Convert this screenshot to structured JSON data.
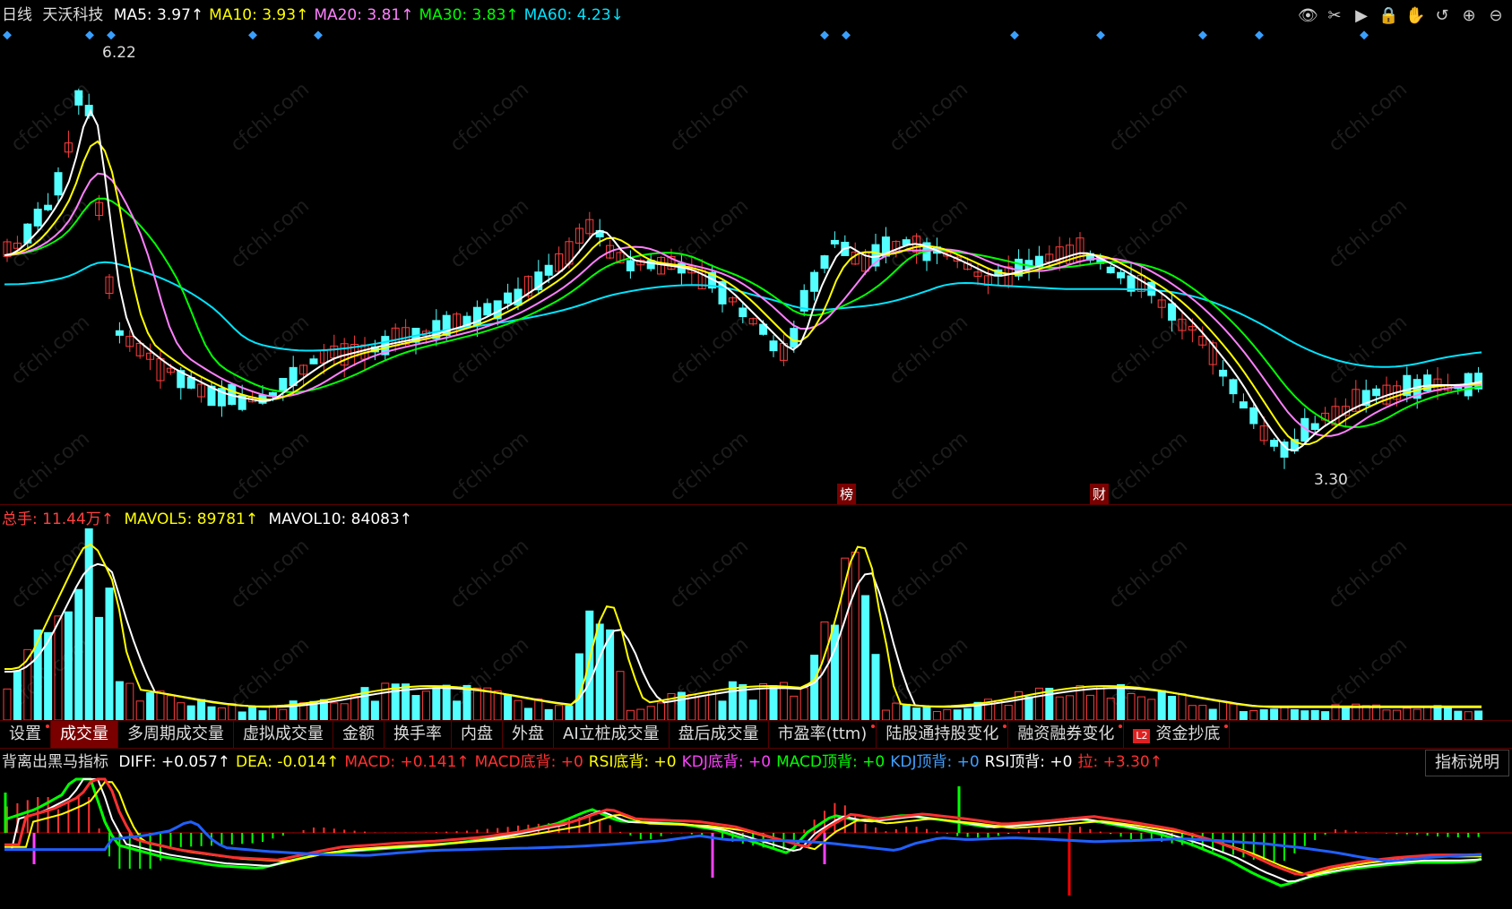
{
  "main": {
    "period": "日线",
    "stock_name": "天沃科技",
    "ma": [
      {
        "label": "MA5: 3.97↑",
        "color": "#ffffff"
      },
      {
        "label": "MA10: 3.93↑",
        "color": "#ffff00"
      },
      {
        "label": "MA20: 3.81↑",
        "color": "#ff80ff"
      },
      {
        "label": "MA30: 3.83↑",
        "color": "#00ff00"
      },
      {
        "label": "MA60: 4.23↓",
        "color": "#00e5ff"
      }
    ],
    "high_label": "6.22",
    "low_label": "3.30",
    "badge_bang": "榜",
    "badge_cai": "财"
  },
  "volume": {
    "total": "总手: 11.44万↑",
    "mavol5": "MAVOL5: 89781↑",
    "mavol10": "MAVOL10: 84083↑"
  },
  "tabs": [
    {
      "label": "设置",
      "dot": true
    },
    {
      "label": "成交量",
      "active": true
    },
    {
      "label": "多周期成交量"
    },
    {
      "label": "虚拟成交量"
    },
    {
      "label": "金额"
    },
    {
      "label": "换手率"
    },
    {
      "label": "内盘"
    },
    {
      "label": "外盘"
    },
    {
      "label": "AI立桩成交量"
    },
    {
      "label": "盘后成交量"
    },
    {
      "label": "市盈率(ttm)",
      "dot": true
    },
    {
      "label": "陆股通持股变化",
      "dot": true
    },
    {
      "label": "融资融券变化",
      "dot": true
    },
    {
      "label": "资金抄底",
      "l2": "L2",
      "dot": true
    }
  ],
  "indicator": {
    "name": "背离出黑马指标",
    "items": [
      {
        "label": "DIFF: +0.057↑",
        "color": "#ffffff"
      },
      {
        "label": "DEA: -0.014↑",
        "color": "#ffff00"
      },
      {
        "label": "MACD: +0.141↑",
        "color": "#ff3030"
      },
      {
        "label": "MACD底背: +0",
        "color": "#ff3030"
      },
      {
        "label": "RSI底背: +0",
        "color": "#ffff00"
      },
      {
        "label": "KDJ底背: +0",
        "color": "#ff40ff"
      },
      {
        "label": "MACD顶背: +0",
        "color": "#00ff00"
      },
      {
        "label": "KDJ顶背: +0",
        "color": "#40a0ff"
      },
      {
        "label": "RSI顶背: +0",
        "color": "#ffffff"
      },
      {
        "label": "拉: +3.30↑",
        "color": "#ff3030"
      }
    ],
    "help_button": "指标说明"
  },
  "toolbar_icons": [
    "eye-icon",
    "scissors-icon",
    "replay-icon",
    "lock-icon",
    "hand-icon",
    "undo-icon",
    "zoom-in-icon",
    "zoom-out-icon"
  ],
  "toolbar_glyphs": [
    "👁",
    "✂",
    "▶",
    "🔒",
    "✋",
    "↺",
    "⊕",
    "⊖"
  ],
  "colors": {
    "up": "#ff3c3c",
    "down": "#54ffff",
    "watermark": "cfchi.com"
  }
}
